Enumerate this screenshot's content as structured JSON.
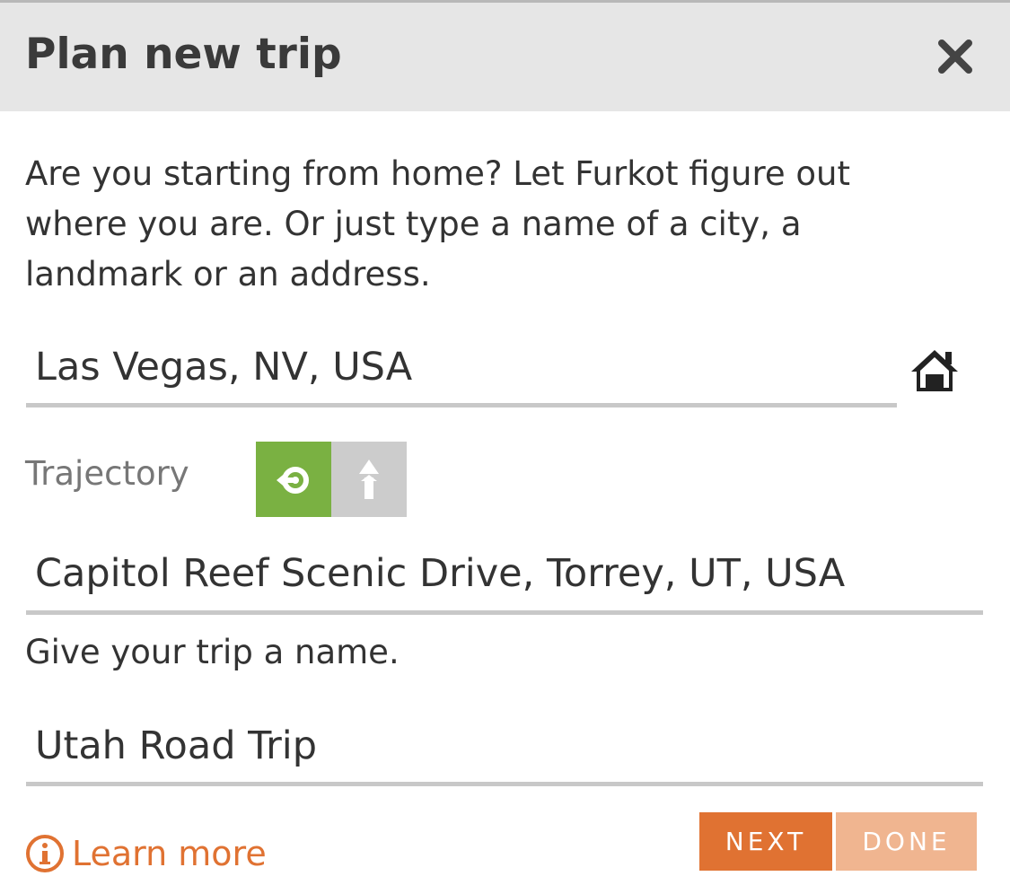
{
  "dialog": {
    "title": "Plan new trip",
    "intro_text": "Are you starting from home? Let Furkot figure out where you are. Or just type a name of a city, a landmark or an address.",
    "close_icon": "close-icon"
  },
  "start": {
    "value": "Las Vegas, NV, USA",
    "home_icon": "home-icon"
  },
  "trajectory": {
    "label": "Trajectory",
    "options": [
      {
        "icon": "round-trip-icon",
        "selected": true
      },
      {
        "icon": "one-way-icon",
        "selected": false
      }
    ]
  },
  "destination": {
    "value": "Capitol Reef Scenic Drive, Torrey, UT, USA"
  },
  "trip_name": {
    "prompt": "Give your trip a name.",
    "value": "Utah Road Trip"
  },
  "footer": {
    "learn_more": "Learn more",
    "info_icon": "info-icon",
    "next_label": "NEXT",
    "done_label": "DONE"
  },
  "colors": {
    "accent": "#e07232",
    "accent_light": "#f0b590",
    "selected_toggle": "#7ab142",
    "unselected_toggle": "#cccccc",
    "header_bg": "#e6e6e6"
  }
}
